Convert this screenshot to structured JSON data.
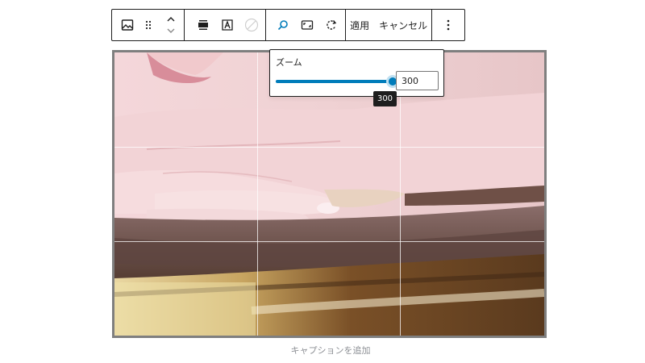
{
  "toolbar": {
    "icons": {
      "block_type": "image-icon",
      "drag": "drag-handle-icon",
      "move_up": "chevron-up-icon",
      "move_down": "chevron-down-icon",
      "align": "align-center-icon",
      "alt_text": "text-in-frame-icon",
      "duotone": "duotone-disabled-icon",
      "zoom": "search-icon",
      "aspect_ratio": "aspect-ratio-icon",
      "rotate": "rotate-icon",
      "more": "more-vertical-icon"
    },
    "apply_label": "適用",
    "cancel_label": "キャンセル"
  },
  "zoom": {
    "label": "ズーム",
    "value": "300",
    "tooltip": "300",
    "slider_fraction": 1.0
  },
  "caption": {
    "placeholder": "キャプションを追加"
  },
  "colors": {
    "accent": "#007cba",
    "toolbar_border": "#1e1e1e",
    "frame_border": "#7f7f7f",
    "caption_text": "#8c8f94"
  }
}
